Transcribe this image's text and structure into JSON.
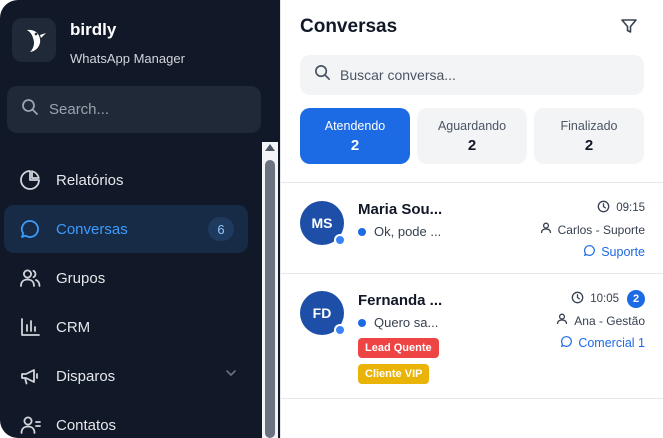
{
  "brand": {
    "name": "birdly",
    "subtitle": "WhatsApp Manager"
  },
  "sidebar": {
    "search_placeholder": "Search...",
    "items": [
      {
        "label": "Relatórios",
        "icon": "pie-chart-icon",
        "active": false
      },
      {
        "label": "Conversas",
        "icon": "chat-bubble-icon",
        "active": true,
        "badge": "6"
      },
      {
        "label": "Grupos",
        "icon": "users-icon",
        "active": false
      },
      {
        "label": "CRM",
        "icon": "bar-chart-icon",
        "active": false
      },
      {
        "label": "Disparos",
        "icon": "megaphone-icon",
        "active": false,
        "has_submenu": true
      },
      {
        "label": "Contatos",
        "icon": "contacts-icon",
        "active": false
      }
    ]
  },
  "main": {
    "title": "Conversas",
    "search_placeholder": "Buscar conversa...",
    "tabs": [
      {
        "label": "Atendendo",
        "count": "2",
        "active": true
      },
      {
        "label": "Aguardando",
        "count": "2",
        "active": false
      },
      {
        "label": "Finalizado",
        "count": "2",
        "active": false
      }
    ],
    "conversations": [
      {
        "initials": "MS",
        "name": "Maria Sou...",
        "preview": "Ok, pode ...",
        "time": "09:15",
        "agent": "Carlos - Suporte",
        "department": "Suporte",
        "unread": "",
        "tags": []
      },
      {
        "initials": "FD",
        "name": "Fernanda ...",
        "preview": "Quero sa...",
        "time": "10:05",
        "agent": "Ana - Gestão",
        "department": "Comercial 1",
        "unread": "2",
        "tags": [
          "Lead Quente",
          "Cliente VIP"
        ]
      }
    ]
  },
  "colors": {
    "sidebar_bg": "#111827",
    "accent": "#1d6ae5",
    "active_nav_text": "#3b9cff",
    "tag_hot": "#ef4444",
    "tag_vip": "#eab308"
  }
}
